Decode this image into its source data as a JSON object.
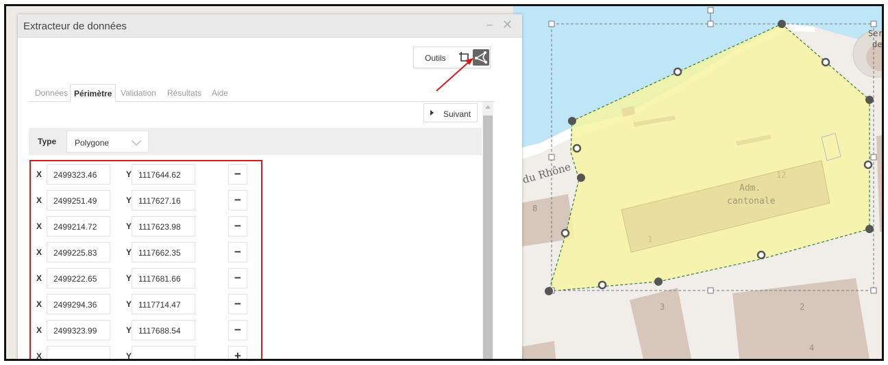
{
  "panel": {
    "title": "Extracteur de données",
    "minimize_icon": "minimize-icon",
    "close_icon": "close-icon",
    "tools_label": "Outils",
    "tools_icons": [
      "crop-icon",
      "polygon-draw-icon"
    ],
    "tabs": [
      {
        "label": "Données",
        "active": false
      },
      {
        "label": "Périmètre",
        "active": true
      },
      {
        "label": "Validation",
        "active": false
      },
      {
        "label": "Résultats",
        "active": false
      },
      {
        "label": "Aide",
        "active": false
      }
    ],
    "next_label": "Suivant",
    "type_label": "Type",
    "type_value": "Polygone",
    "x_label": "X",
    "y_label": "Y",
    "coordinates": [
      {
        "x": "2499323.46",
        "y": "1117644.62",
        "action": "−"
      },
      {
        "x": "2499251.49",
        "y": "1117627.16",
        "action": "−"
      },
      {
        "x": "2499214.72",
        "y": "1117623.98",
        "action": "−"
      },
      {
        "x": "2499225.83",
        "y": "1117662.35",
        "action": "−"
      },
      {
        "x": "2499222.65",
        "y": "1117681.66",
        "action": "−"
      },
      {
        "x": "2499294.36",
        "y": "1117714.47",
        "action": "−"
      },
      {
        "x": "2499323.99",
        "y": "1117688.54",
        "action": "−"
      },
      {
        "x": "",
        "y": "",
        "action": "+"
      }
    ]
  },
  "map": {
    "street_label": "ai du Rhône",
    "building_label_line1": "Adm.",
    "building_label_line2": "cantonale",
    "numbers": [
      "12",
      "1",
      "8",
      "3",
      "2",
      "4"
    ],
    "partial_label_1": "Serv",
    "partial_label_2": "de",
    "colors": {
      "water": "#bfe6f7",
      "polygon_fill": "#f6f3a2",
      "building": "#d6c6bb",
      "highlight": "#d8161b"
    }
  }
}
